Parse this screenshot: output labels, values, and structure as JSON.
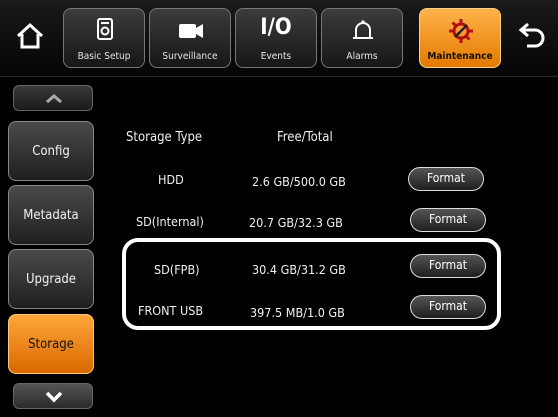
{
  "header": {
    "tabs": [
      {
        "id": "basic-setup",
        "label": "Basic Setup"
      },
      {
        "id": "surveillance",
        "label": "Surveillance"
      },
      {
        "id": "events",
        "label": "Events",
        "glyph": "I/O"
      },
      {
        "id": "alarms",
        "label": "Alarms"
      },
      {
        "id": "maintenance",
        "label": "Maintenance",
        "active": true
      }
    ],
    "home_icon": "home-icon",
    "back_icon": "back-arrow-icon"
  },
  "sidebar": {
    "items": [
      {
        "label": "Config"
      },
      {
        "label": "Metadata"
      },
      {
        "label": "Upgrade"
      },
      {
        "label": "Storage",
        "active": true
      }
    ]
  },
  "storage": {
    "headers": {
      "type": "Storage Type",
      "free_total": "Free/Total"
    },
    "rows": [
      {
        "type": "HDD",
        "free_total": "2.6 GB/500.0 GB",
        "action": "Format"
      },
      {
        "type": "SD(Internal)",
        "free_total": "20.7 GB/32.3 GB",
        "action": "Format"
      },
      {
        "type": "SD(FPB)",
        "free_total": "30.4 GB/31.2 GB",
        "action": "Format"
      },
      {
        "type": "FRONT USB",
        "free_total": "397.5 MB/1.0 GB",
        "action": "Format"
      }
    ]
  },
  "colors": {
    "accent": "#f08a10",
    "background": "#000000"
  }
}
